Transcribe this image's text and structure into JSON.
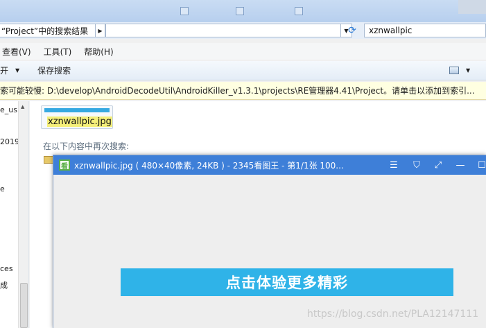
{
  "window": {
    "close_ghost": ""
  },
  "address": {
    "breadcrumb": "“Project”中的搜索结果",
    "path_value": "",
    "search_value": "xznwallpic"
  },
  "menu": {
    "items": [
      "查看(V)",
      "工具(T)",
      "帮助(H)"
    ]
  },
  "toolbar": {
    "open_label": "开",
    "save_search_label": "保存搜索"
  },
  "infobar": {
    "text": "索可能较慢: D:\\develop\\AndroidDecodeUtil\\AndroidKiller_v1.3.1\\projects\\RE管理器4.41\\Project。请单击以添加到索引..."
  },
  "nav": {
    "items": [
      "e_us",
      "2019",
      "e",
      "ces",
      "成"
    ]
  },
  "results": {
    "file_name": "xznwallpic.jpg",
    "search_again_label": "在以下内容中再次搜索:"
  },
  "viewer": {
    "icon_glyph": "看",
    "title": "xznwallpic.jpg ( 480×40像素, 24KB ) - 2345看图王 - 第1/1张 100...",
    "banner_text": "点击体验更多精彩",
    "colors": {
      "title_bg": "#3e7fd8",
      "banner_bg": "#2fb3e8"
    }
  },
  "watermark": "https://blog.csdn.net/PLA12147111"
}
